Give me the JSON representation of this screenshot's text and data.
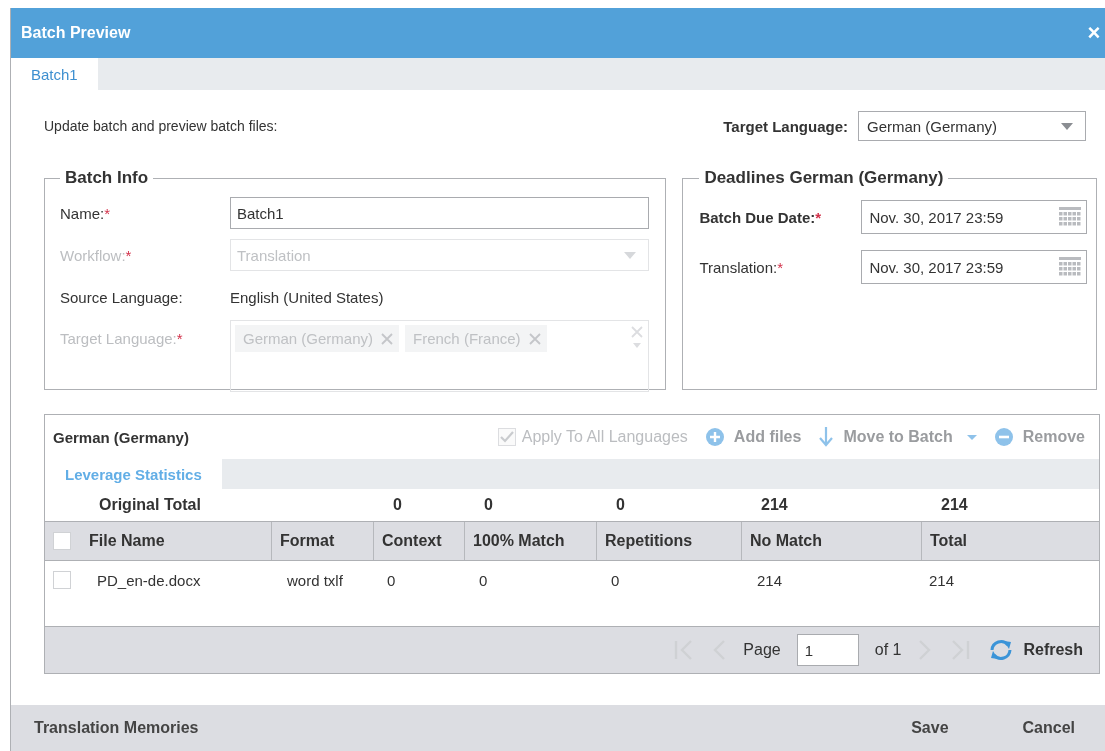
{
  "window": {
    "title": "Batch Preview",
    "close": "×"
  },
  "tabs": [
    {
      "label": "Batch1",
      "selected": true
    }
  ],
  "intro": "Update batch and preview batch files:",
  "target_language_select": {
    "label": "Target Language:",
    "value": "German (Germany)"
  },
  "batch_info": {
    "title": "Batch Info",
    "name": {
      "label": "Name:",
      "required_mark": "*",
      "value": "Batch1",
      "disabled": false
    },
    "workflow": {
      "label": "Workflow:",
      "required_mark": "*",
      "value": "Translation",
      "disabled": true
    },
    "source_language": {
      "label": "Source Language:",
      "value": "English (United States)"
    },
    "target_language": {
      "label": "Target Language:",
      "required_mark": "*",
      "disabled": true,
      "tags": [
        "German (Germany)",
        "French (France)"
      ]
    }
  },
  "deadlines": {
    "title": "Deadlines German (Germany)",
    "fields": [
      {
        "label": "Batch Due Date:",
        "required_mark": "*",
        "value": "Nov. 30, 2017 23:59",
        "bold": true
      },
      {
        "label": "Translation:",
        "required_mark": "*",
        "value": "Nov. 30, 2017 23:59",
        "bold": false
      }
    ]
  },
  "files_panel": {
    "language": "German (Germany)",
    "apply_all": {
      "label": "Apply To All Languages",
      "checked": true,
      "disabled": true
    },
    "toolbar": [
      {
        "label": "Add files",
        "kind": "add",
        "disabled": true
      },
      {
        "label": "Move to Batch",
        "kind": "move",
        "disabled": true
      },
      {
        "label": "Remove",
        "kind": "remove",
        "disabled": true
      }
    ],
    "subtabs": [
      {
        "label": "Leverage Statistics",
        "selected": true
      }
    ],
    "original_total": {
      "label": "Original Total",
      "values": [
        "0",
        "0",
        "0",
        "214",
        "214"
      ]
    },
    "table": {
      "columns": [
        "File Name",
        "Format",
        "Context",
        "100% Match",
        "Repetitions",
        "No Match",
        "Total"
      ],
      "all_checked": false,
      "rows": [
        {
          "checked": false,
          "cells": [
            "PD_en-de.docx",
            "word txlf",
            "0",
            "0",
            "0",
            "214",
            "214"
          ]
        }
      ]
    },
    "pager": {
      "page_label": "Page",
      "page": "1",
      "of": "of 1",
      "refresh": "Refresh"
    }
  },
  "footer": {
    "left": "Translation Memories",
    "buttons": [
      "Save",
      "Cancel"
    ]
  }
}
